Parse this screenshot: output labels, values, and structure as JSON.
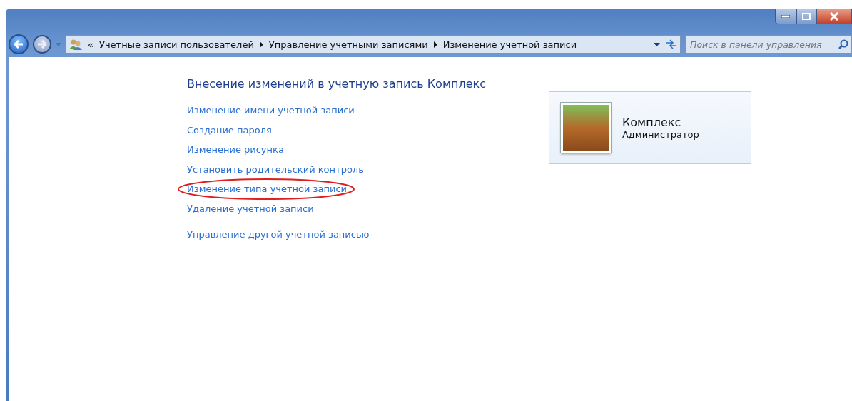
{
  "address_bar": {
    "overflow": "«",
    "crumbs": [
      "Учетные записи пользователей",
      "Управление учетными записями",
      "Изменение учетной записи"
    ]
  },
  "search": {
    "placeholder": "Поиск в панели управления"
  },
  "heading": "Внесение изменений в учетную запись Комплекс",
  "link_groups": [
    [
      {
        "label": "Изменение имени учетной записи",
        "circled": false
      },
      {
        "label": "Создание пароля",
        "circled": false
      },
      {
        "label": "Изменение рисунка",
        "circled": false
      },
      {
        "label": "Установить родительский контроль",
        "circled": false
      },
      {
        "label": "Изменение типа учетной записи",
        "circled": true
      },
      {
        "label": "Удаление учетной записи",
        "circled": false
      }
    ],
    [
      {
        "label": "Управление другой учетной записью",
        "circled": false
      }
    ]
  ],
  "account": {
    "name": "Комплекс",
    "role": "Администратор"
  }
}
